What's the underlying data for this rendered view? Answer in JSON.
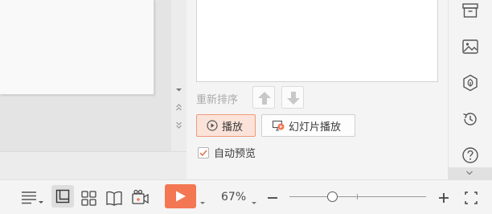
{
  "animation_pane": {
    "reorder_label": "重新排序",
    "play_label": "播放",
    "slideshow_label": "幻灯片播放",
    "auto_preview_label": "自动预览",
    "auto_preview_checked": true
  },
  "right_rail": {
    "icons": [
      "archive-icon",
      "image-icon",
      "shield-leaf-icon",
      "history-icon",
      "help-icon"
    ]
  },
  "status_bar": {
    "zoom_label": "67%",
    "zoom_value_percent": 67
  },
  "colors": {
    "accent": "#f47754",
    "play_button_bg": "#fbe3d9",
    "play_button_border": "#ef9a78"
  }
}
